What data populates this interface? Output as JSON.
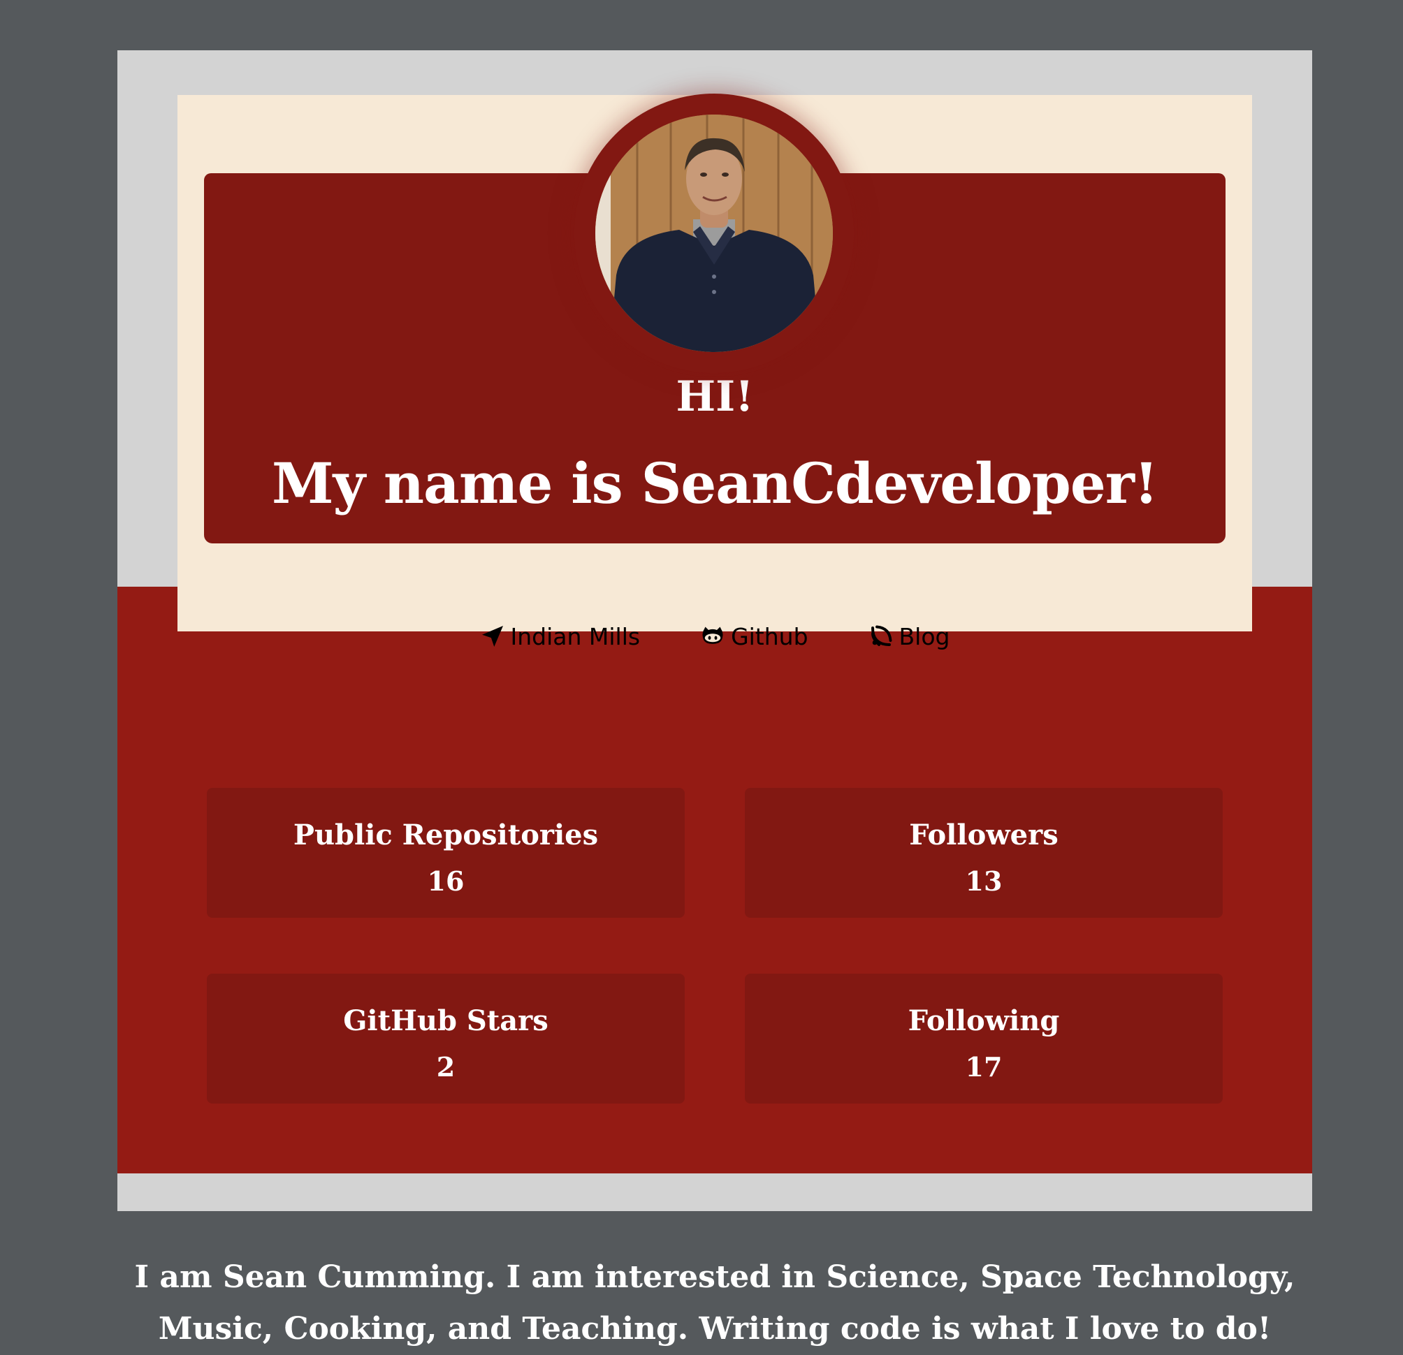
{
  "header": {
    "greeting": "HI!",
    "name_line": "My name is SeanCdeveloper!"
  },
  "avatar": {
    "alt": "Profile photo of Sean Cumming"
  },
  "links": [
    {
      "label": "Indian Mills",
      "icon": "location-arrow-icon"
    },
    {
      "label": "Github",
      "icon": "github-icon"
    },
    {
      "label": "Blog",
      "icon": "rss-icon"
    }
  ],
  "bio": {
    "line1": "I am Sean Cumming. I am interested in Science, Space Technology,",
    "line2": "Music, Cooking, and Teaching. Writing code is what I love to do!"
  },
  "stats": [
    {
      "label": "Public Repositories",
      "value": "16"
    },
    {
      "label": "Followers",
      "value": "13"
    },
    {
      "label": "GitHub Stars",
      "value": "2"
    },
    {
      "label": "Following",
      "value": "17"
    }
  ],
  "colors": {
    "background": "#55595c",
    "page": "#d3d3d3",
    "card": "#f7e9d6",
    "banner": "#821812",
    "band": "#941b14"
  }
}
